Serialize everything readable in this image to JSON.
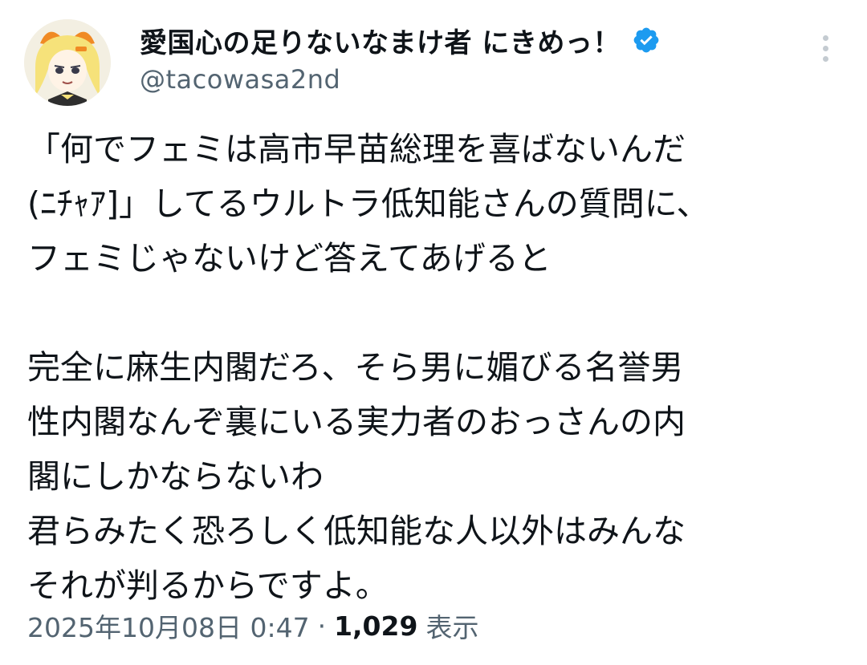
{
  "author": {
    "display_name": "愛国心の足りないなまけ者 にきめっ！",
    "handle": "@tacowasa2nd",
    "verified": true,
    "avatar": "anime-character-avatar"
  },
  "tweet": {
    "lines": [
      "「何でフェミは高市早苗総理を喜ばないんだ",
      "(ﾆﾁｬｱ]」してるウルトラ低知能さんの質問に、",
      "フェミじゃないけど答えてあげると",
      "",
      "完全に麻生内閣だろ、そら男に媚びる名誉男",
      "性内閣なんぞ裏にいる実力者のおっさんの内",
      "閣にしかならないわ",
      "君らみたく恐ろしく低知能な人以外はみんな",
      "それが判るからですよ。"
    ],
    "timestamp": "2025年10月08日 0:47",
    "separator": "·",
    "views_count": "1,029",
    "views_label": "表示"
  },
  "colors": {
    "text": "#0f1419",
    "secondary": "#536471",
    "verified": "#1d9bf0",
    "more_dots": "#c4cbd1"
  },
  "icons": {
    "verified": "verified-badge-icon",
    "more": "more-options-icon"
  }
}
